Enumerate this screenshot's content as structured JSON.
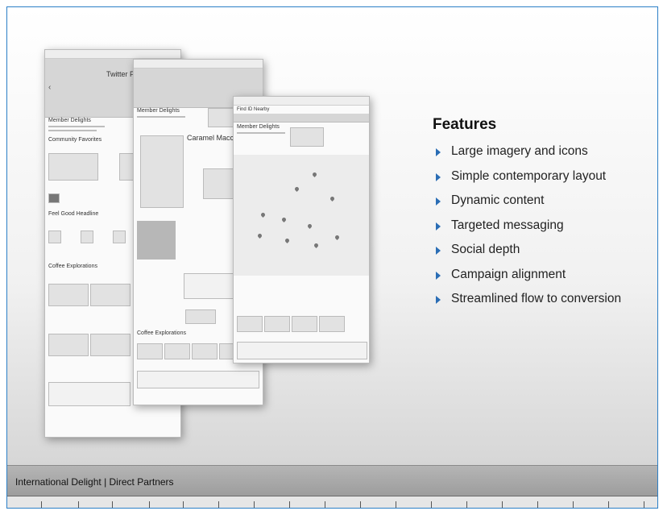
{
  "features": {
    "title": "Features",
    "items": [
      "Large imagery and icons",
      "Simple contemporary layout",
      "Dynamic content",
      "Targeted messaging",
      "Social depth",
      "Campaign alignment",
      "Streamlined flow to conversion"
    ]
  },
  "footer": {
    "text": "International Delight | Direct Partners"
  },
  "wireframes": {
    "page1": {
      "hero_title": "Twitter Par",
      "section1": "Member Delights",
      "section2": "Community Favorites",
      "section3": "Feel Good Headline",
      "section4": "Coffee Explorations"
    },
    "page2": {
      "section1": "Member Delights",
      "product": "Caramel Macchi",
      "section2": "Coffee Explorations"
    },
    "page3": {
      "finder": "Find ID Nearby",
      "section1": "Member Delights"
    }
  }
}
